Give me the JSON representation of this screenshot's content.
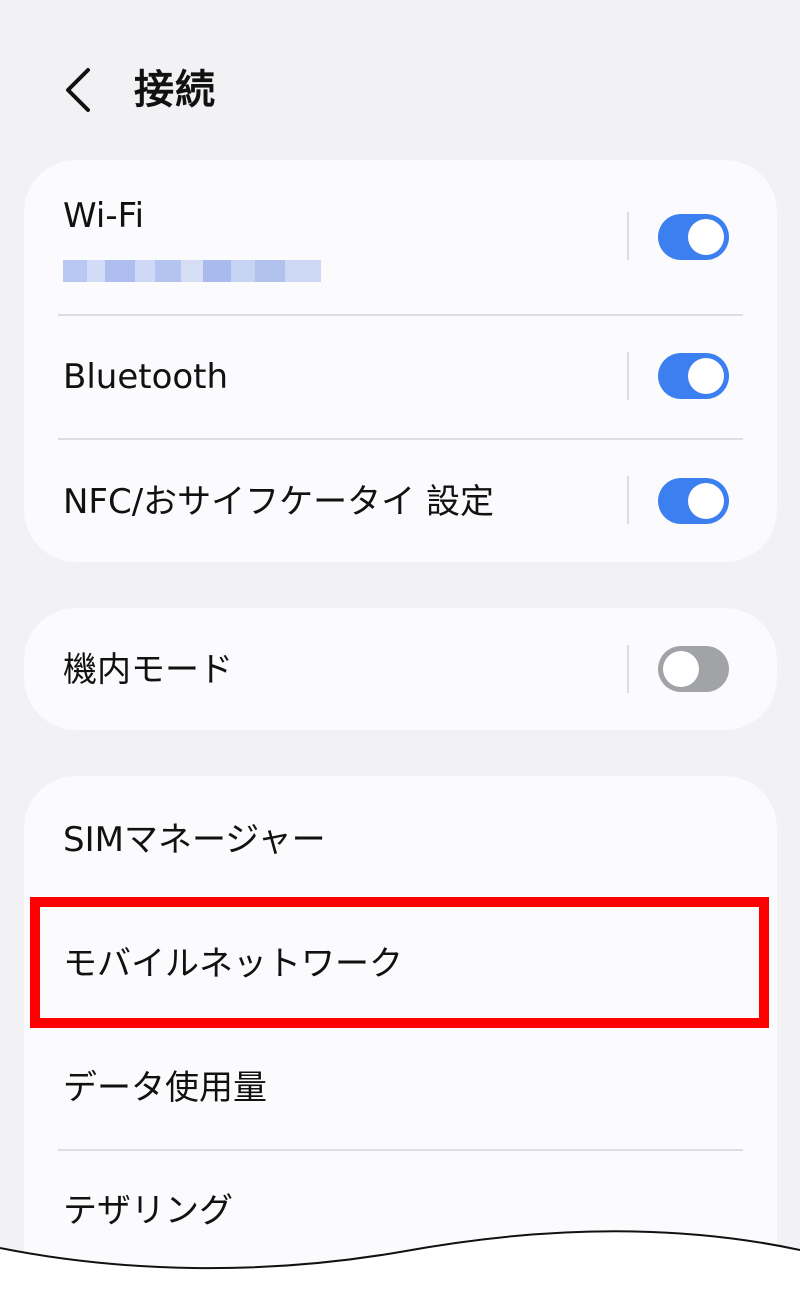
{
  "header": {
    "title": "接続",
    "back_icon": "chevron-left-icon"
  },
  "connectivity": {
    "wifi": {
      "label": "Wi-Fi",
      "network_name_blurred": true,
      "enabled": true
    },
    "bluetooth": {
      "label": "Bluetooth",
      "enabled": true
    },
    "nfc": {
      "label": "NFC/おサイフケータイ 設定",
      "enabled": true
    }
  },
  "airplane": {
    "label": "機内モード",
    "enabled": false
  },
  "network": {
    "items": [
      {
        "label": "SIMマネージャー"
      },
      {
        "label": "モバイルネットワーク",
        "highlighted": true
      },
      {
        "label": "データ使用量"
      },
      {
        "label": "テザリング"
      }
    ]
  },
  "colors": {
    "toggle_on": "#3b7ff0",
    "toggle_off": "#a2a3a7",
    "highlight": "#ff0000",
    "background": "#f2f2f4",
    "card": "#fbfbfd"
  }
}
